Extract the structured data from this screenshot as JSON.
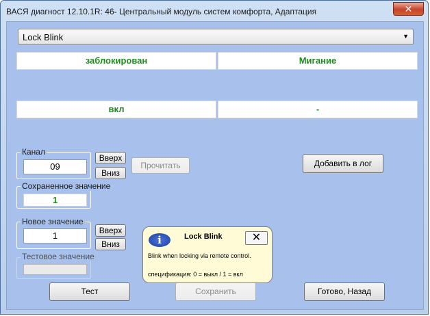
{
  "window": {
    "title": "ВАСЯ диагност 12.10.1R: 46- Центральный модуль систем комфорта, Адаптация",
    "close_glyph": "✕"
  },
  "combo": {
    "selected": "Lock Blink",
    "arrow": "▼"
  },
  "values": {
    "row1_left": "заблокирован",
    "row1_right": "Мигание",
    "row2_left": "вкл",
    "row2_right": "-"
  },
  "channel": {
    "label": "Канал",
    "value": "09",
    "up_label": "Вверх",
    "down_label": "Вниз",
    "read_label": "Прочитать"
  },
  "saved": {
    "label": "Сохраненное значение",
    "value": "1"
  },
  "new_value": {
    "label": "Новое значение",
    "value": "1",
    "up_label": "Вверх",
    "down_label": "Вниз"
  },
  "test_value": {
    "label": "Тестовое значение",
    "value": ""
  },
  "buttons": {
    "add_to_log": "Добавить в лог",
    "test": "Тест",
    "save": "Сохранить",
    "done_back": "Готово, Назад"
  },
  "tooltip": {
    "title": "Lock Blink",
    "body": "Blink when locking via remote control.",
    "spec": "спецификация: 0 = выкл / 1 = вкл",
    "close_glyph": "✕",
    "icon_glyph": "i"
  },
  "colors": {
    "value_green": "#1f8a1f",
    "client_bg": "#a7c1ec"
  }
}
